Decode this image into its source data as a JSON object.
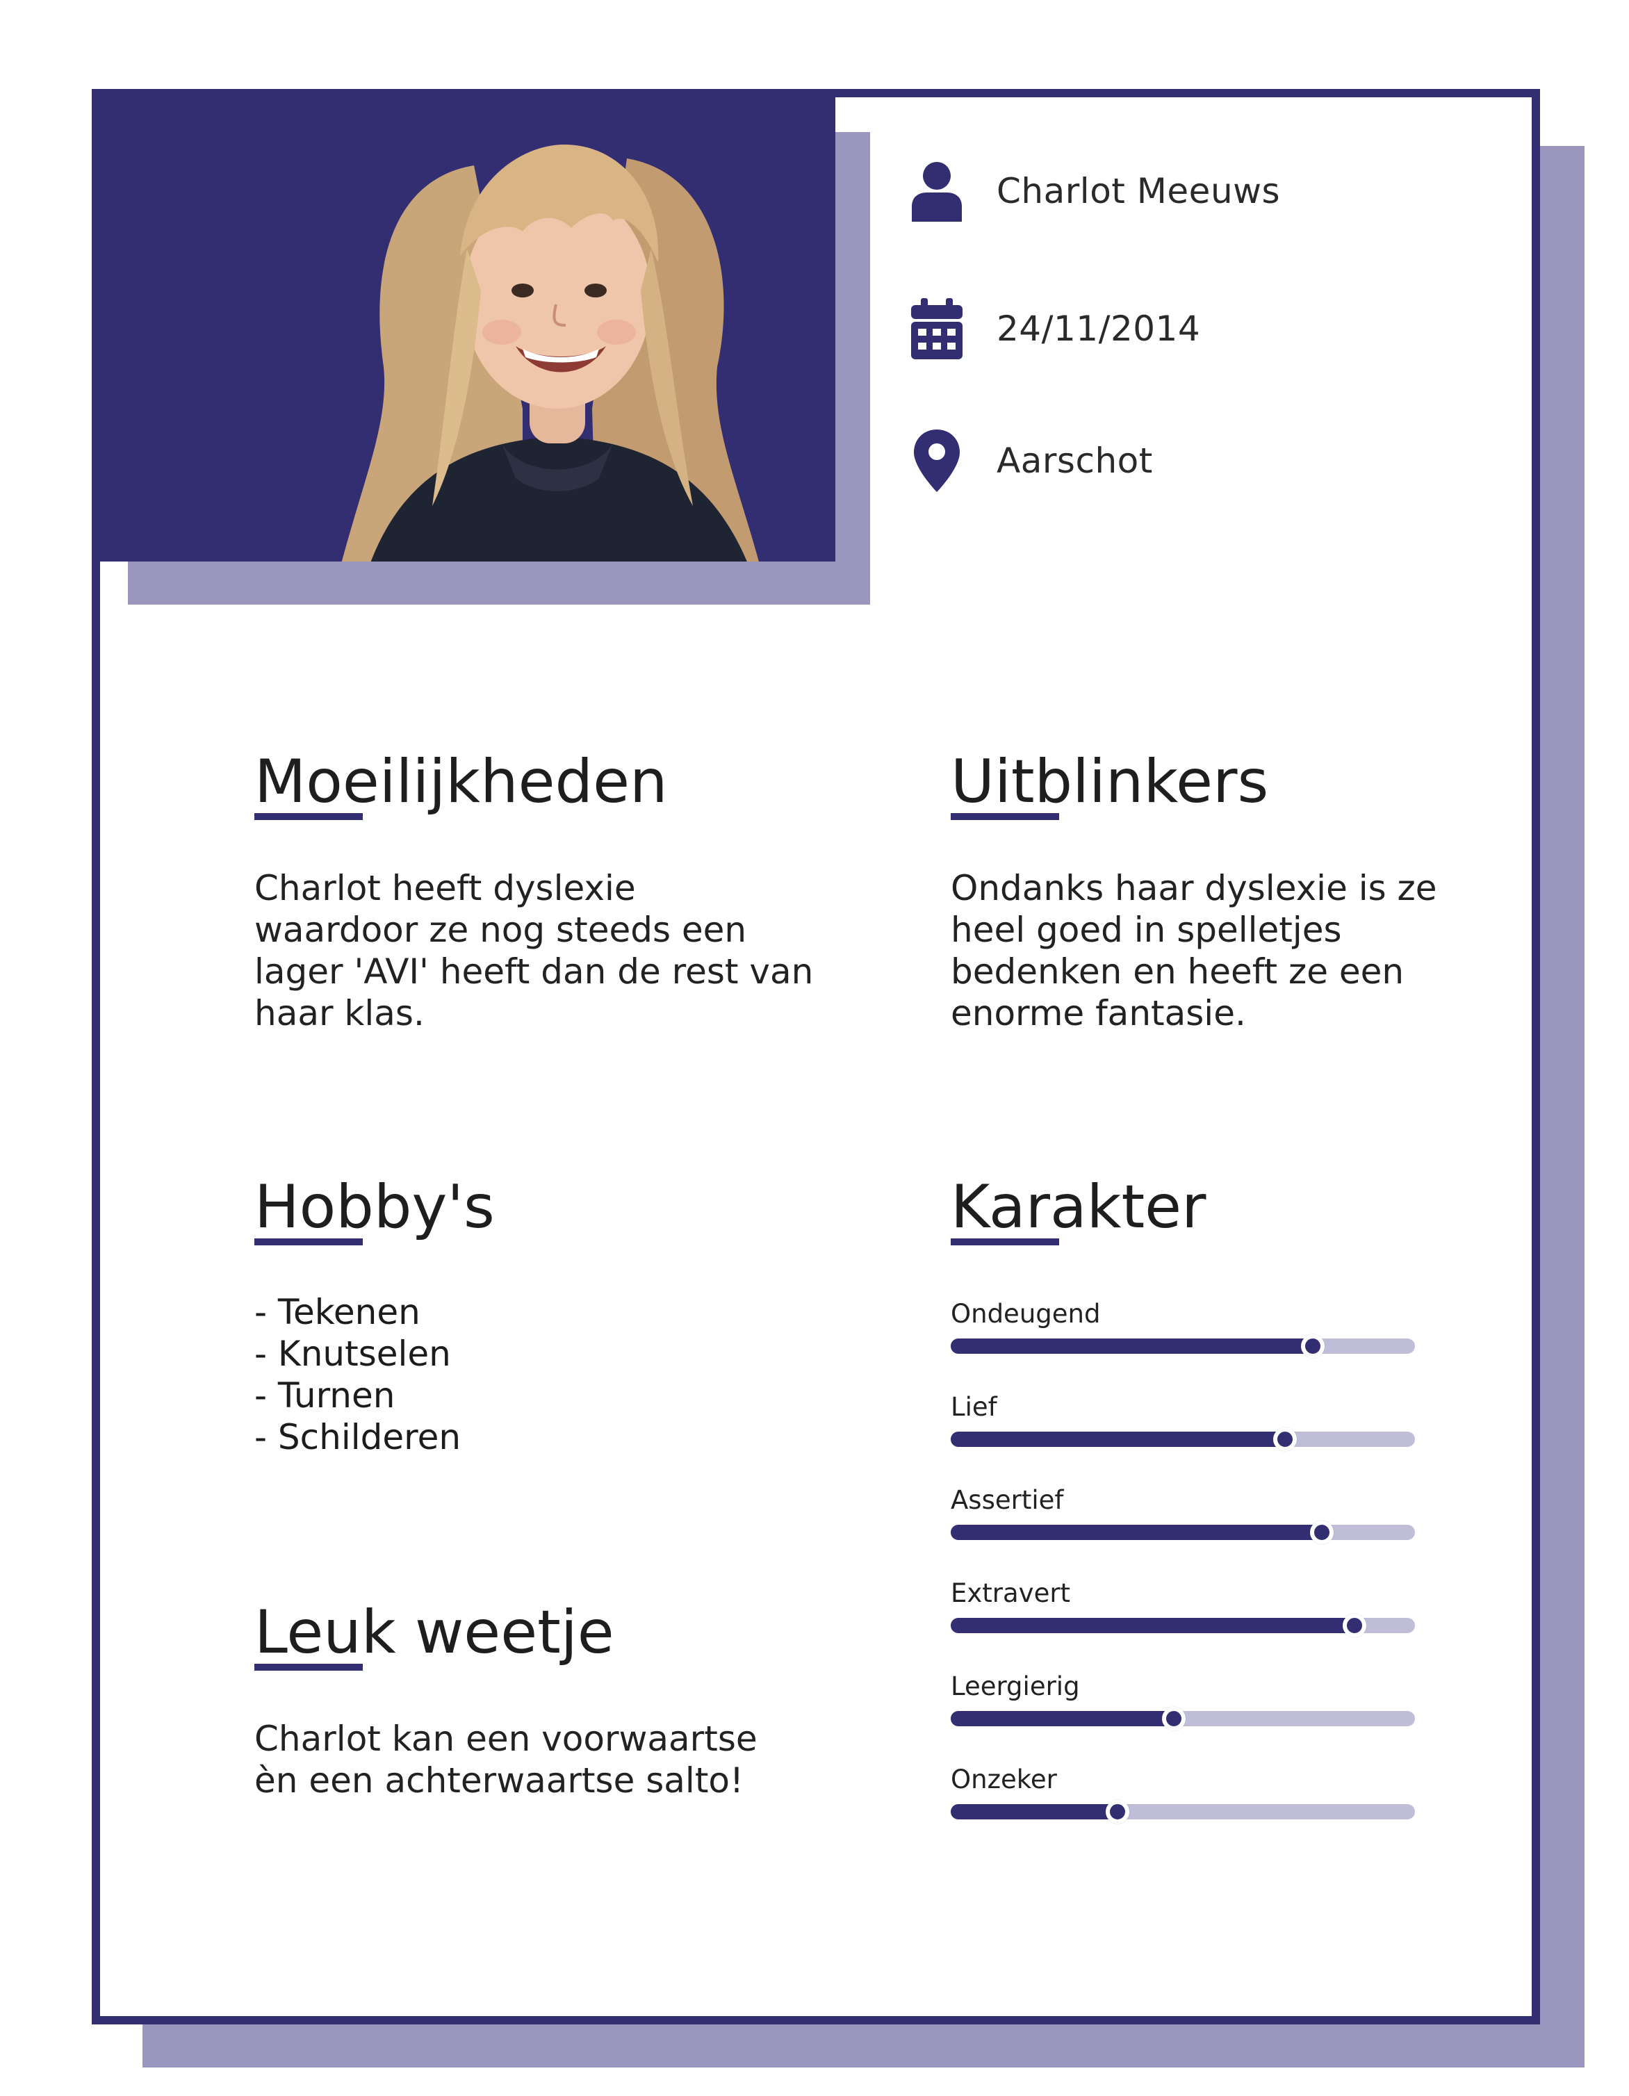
{
  "colors": {
    "accent": "#332d72",
    "shadow": "#9a96bd",
    "track": "#c0bdd9"
  },
  "profile": {
    "name": "Charlot Meeuws",
    "birthdate": "24/11/2014",
    "location": "Aarschot",
    "icons": {
      "name": "user-icon",
      "birthdate": "calendar-icon",
      "location": "map-pin-icon"
    }
  },
  "sections": {
    "moeilijkheden": {
      "title": "Moeilijkheden",
      "lines": [
        "Charlot heeft dyslexie",
        "waardoor ze nog steeds een",
        "lager 'AVI' heeft dan de rest van",
        "haar klas."
      ]
    },
    "uitblinkers": {
      "title": "Uitblinkers",
      "lines": [
        "Ondanks haar dyslexie is ze",
        "heel goed in spelletjes",
        "bedenken en heeft ze een",
        "enorme fantasie."
      ]
    },
    "hobbys": {
      "title": "Hobby's",
      "items": [
        "- Tekenen",
        "- Knutselen",
        "- Turnen",
        "- Schilderen"
      ]
    },
    "weetje": {
      "title": "Leuk weetje",
      "lines": [
        "Charlot kan een voorwaartse",
        "èn een achterwaartse salto!"
      ]
    },
    "karakter": {
      "title": "Karakter",
      "traits": [
        {
          "label": "Ondeugend",
          "level": 0.78
        },
        {
          "label": "Lief",
          "level": 0.72
        },
        {
          "label": "Assertief",
          "level": 0.8
        },
        {
          "label": "Extravert",
          "level": 0.87
        },
        {
          "label": "Leergierig",
          "level": 0.48
        },
        {
          "label": "Onzeker",
          "level": 0.36
        }
      ]
    }
  }
}
